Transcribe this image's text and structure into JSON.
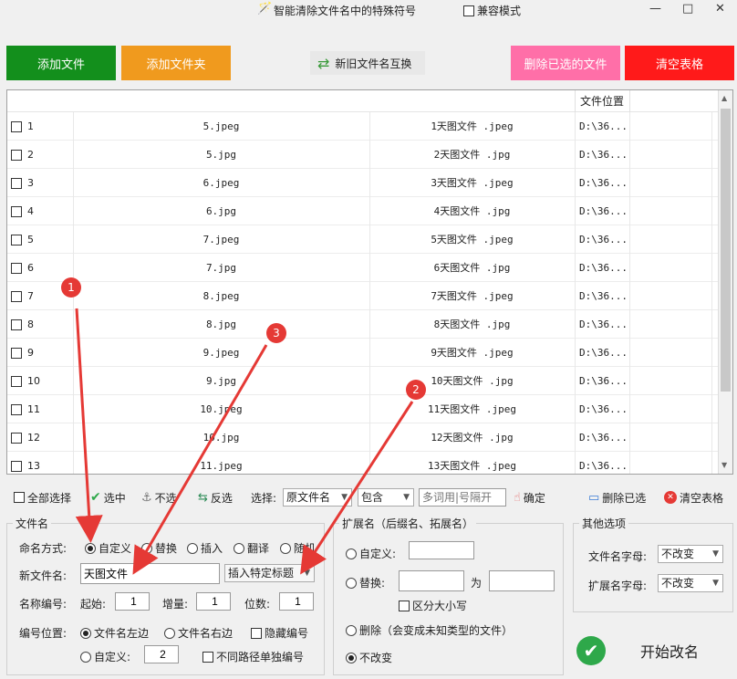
{
  "title": "智能清除文件名中的特殊符号",
  "compat_label": "兼容模式",
  "window": {
    "minimize": "—",
    "maximize": "□",
    "close": "✕"
  },
  "buttons": {
    "add_file": "添加文件",
    "add_folder": "添加文件夹",
    "swap_names": "新旧文件名互换",
    "delete_selected": "删除已选的文件",
    "clear_table": "清空表格"
  },
  "colors": {
    "green": "#138f1c",
    "orange": "#f09a1e",
    "pink": "#ff6fa8",
    "red": "#ff1a1a"
  },
  "table": {
    "header_location": "文件位置",
    "rows": [
      {
        "n": "1",
        "orig": "5.jpeg",
        "new": "1天图文件 .jpeg",
        "loc": "D:\\36..."
      },
      {
        "n": "2",
        "orig": "5.jpg",
        "new": "2天图文件 .jpg",
        "loc": "D:\\36..."
      },
      {
        "n": "3",
        "orig": "6.jpeg",
        "new": "3天图文件 .jpeg",
        "loc": "D:\\36..."
      },
      {
        "n": "4",
        "orig": "6.jpg",
        "new": "4天图文件 .jpg",
        "loc": "D:\\36..."
      },
      {
        "n": "5",
        "orig": "7.jpeg",
        "new": "5天图文件 .jpeg",
        "loc": "D:\\36..."
      },
      {
        "n": "6",
        "orig": "7.jpg",
        "new": "6天图文件 .jpg",
        "loc": "D:\\36..."
      },
      {
        "n": "7",
        "orig": "8.jpeg",
        "new": "7天图文件 .jpeg",
        "loc": "D:\\36..."
      },
      {
        "n": "8",
        "orig": "8.jpg",
        "new": "8天图文件 .jpg",
        "loc": "D:\\36..."
      },
      {
        "n": "9",
        "orig": "9.jpeg",
        "new": "9天图文件 .jpeg",
        "loc": "D:\\36..."
      },
      {
        "n": "10",
        "orig": "9.jpg",
        "new": "10天图文件 .jpg",
        "loc": "D:\\36..."
      },
      {
        "n": "11",
        "orig": "10.jpeg",
        "new": "11天图文件 .jpeg",
        "loc": "D:\\36..."
      },
      {
        "n": "12",
        "orig": "10.jpg",
        "new": "12天图文件 .jpg",
        "loc": "D:\\36..."
      },
      {
        "n": "13",
        "orig": "11.jpeg",
        "new": "13天图文件 .jpeg",
        "loc": "D:\\36..."
      }
    ]
  },
  "toolbar": {
    "select_all": "全部选择",
    "select": "选中",
    "deselect": "不选",
    "invert": "反选",
    "choose_label": "选择:",
    "field_select": "原文件名",
    "match_select": "包含",
    "keyword_placeholder": "多词用|号隔开",
    "confirm": "确定",
    "delete_selected": "删除已选",
    "clear_table": "清空表格"
  },
  "filename": {
    "title": "文件名",
    "mode_label": "命名方式:",
    "modes": [
      "自定义",
      "替换",
      "插入",
      "翻译",
      "随机"
    ],
    "new_name_label": "新文件名:",
    "new_name_value": "天图文件",
    "insert_title": "插入特定标题",
    "numbering_label": "名称编号:",
    "start_label": "起始:",
    "start_value": "1",
    "step_label": "增量:",
    "step_value": "1",
    "digits_label": "位数:",
    "digits_value": "1",
    "position_label": "编号位置:",
    "pos_left": "文件名左边",
    "pos_right": "文件名右边",
    "hide_number": "隐藏编号",
    "custom": "自定义:",
    "custom_value": "2",
    "separate_paths": "不同路径单独编号"
  },
  "extension": {
    "title": "扩展名（后缀名、拓展名）",
    "custom": "自定义:",
    "replace": "替换:",
    "to": "为",
    "case_sensitive": "区分大小写",
    "delete": "删除（会变成未知类型的文件）",
    "unchanged": "不改变"
  },
  "other": {
    "title": "其他选项",
    "name_case_label": "文件名字母:",
    "name_case_value": "不改变",
    "ext_case_label": "扩展名字母:",
    "ext_case_value": "不改变"
  },
  "start_rename": "开始改名",
  "markers": [
    "1",
    "2",
    "3"
  ]
}
